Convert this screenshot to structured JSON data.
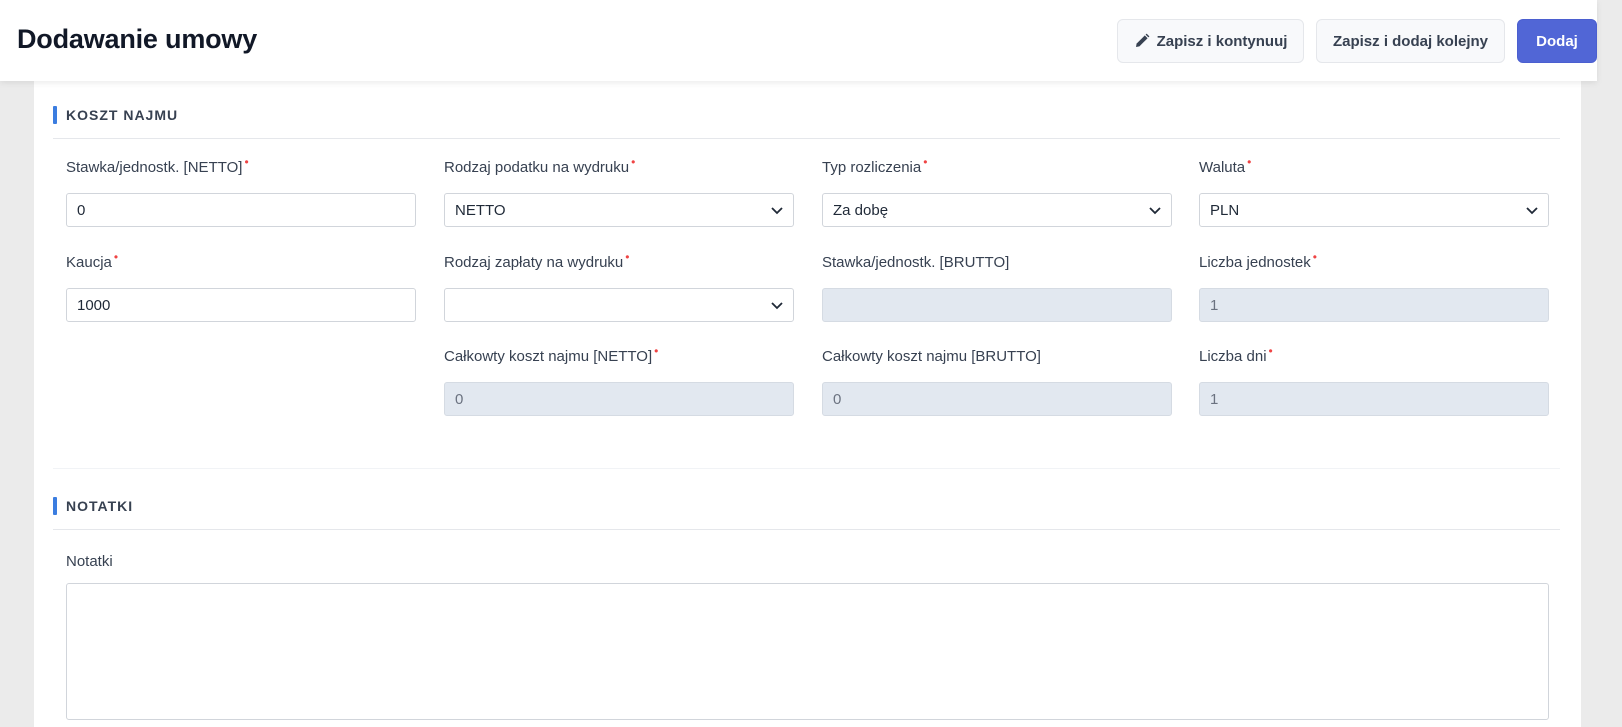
{
  "header": {
    "title": "Dodawanie umowy",
    "buttons": {
      "save_continue": "Zapisz i kontynuuj",
      "save_add_next": "Zapisz i dodaj kolejny",
      "add": "Dodaj"
    }
  },
  "sections": {
    "cost": {
      "title": "KOSZT NAJMU"
    },
    "notes": {
      "title": "NOTATKI"
    }
  },
  "fields": {
    "rate_net": {
      "label": "Stawka/jednostk. [NETTO]",
      "value": "0",
      "required": true
    },
    "tax_type": {
      "label": "Rodzaj podatku na wydruku",
      "value": "NETTO",
      "required": true
    },
    "settlement_type": {
      "label": "Typ rozliczenia",
      "value": "Za dobę",
      "required": true
    },
    "currency": {
      "label": "Waluta",
      "value": "PLN",
      "required": true
    },
    "deposit": {
      "label": "Kaucja",
      "value": "1000",
      "required": true
    },
    "payment_type": {
      "label": "Rodzaj zapłaty na wydruku",
      "value": "",
      "required": true
    },
    "rate_gross": {
      "label": "Stawka/jednostk. [BRUTTO]",
      "value": "",
      "required": false
    },
    "unit_count": {
      "label": "Liczba jednostek",
      "value": "1",
      "required": true
    },
    "total_net": {
      "label": "Całkowty koszt najmu [NETTO]",
      "value": "0",
      "required": true
    },
    "total_gross": {
      "label": "Całkowty koszt najmu [BRUTTO]",
      "value": "0",
      "required": false
    },
    "days_count": {
      "label": "Liczba dni",
      "value": "1",
      "required": true
    },
    "notes": {
      "label": "Notatki",
      "value": ""
    }
  },
  "required_marker": "•",
  "icons": {
    "edit": "pencil-icon",
    "dropdown": "chevron-down-icon"
  },
  "colors": {
    "primary": "#5166d6",
    "accent": "#3b7de0",
    "required": "#ef4444",
    "disabled_bg": "#e2e8f0"
  }
}
